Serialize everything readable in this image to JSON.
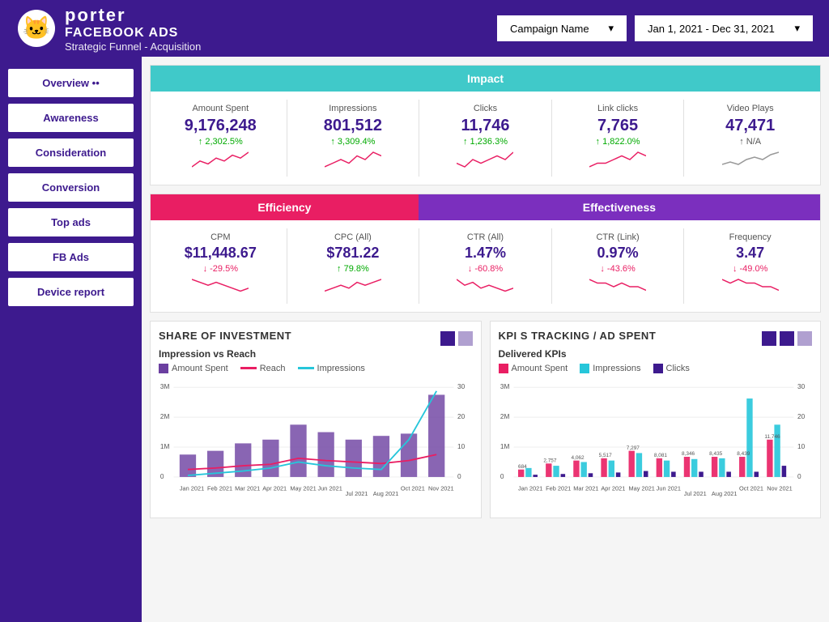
{
  "header": {
    "brand": "porter",
    "ad_platform": "FACEBOOK ADS",
    "subtitle": "Strategic Funnel - Acquisition",
    "campaign_dropdown": {
      "label": "Campaign Name",
      "arrow": "▾"
    },
    "date_dropdown": {
      "label": "Jan 1, 2021 - Dec 31, 2021",
      "arrow": "▾"
    }
  },
  "sidebar": {
    "items": [
      {
        "id": "overview",
        "label": "Overview ••"
      },
      {
        "id": "awareness",
        "label": "Awareness"
      },
      {
        "id": "consideration",
        "label": "Consideration"
      },
      {
        "id": "conversion",
        "label": "Conversion"
      },
      {
        "id": "top-ads",
        "label": "Top ads"
      },
      {
        "id": "fb-ads",
        "label": "FB Ads"
      },
      {
        "id": "device-report",
        "label": "Device report"
      }
    ]
  },
  "impact": {
    "section_title": "Impact",
    "metrics": [
      {
        "label": "Amount Spent",
        "value": "9,176,248",
        "change": "↑ 2,302.5%",
        "direction": "up"
      },
      {
        "label": "Impressions",
        "value": "801,512",
        "change": "↑ 3,309.4%",
        "direction": "up"
      },
      {
        "label": "Clicks",
        "value": "11,746",
        "change": "↑ 1,236.3%",
        "direction": "up"
      },
      {
        "label": "Link clicks",
        "value": "7,765",
        "change": "↑ 1,822.0%",
        "direction": "up"
      },
      {
        "label": "Video Plays",
        "value": "47,471",
        "change": "↑ N/A",
        "direction": "neutral"
      }
    ]
  },
  "efficiency": {
    "header": "Efficiency",
    "metrics": [
      {
        "label": "CPM",
        "value": "$11,448.67",
        "change": "↓ -29.5%",
        "direction": "down"
      },
      {
        "label": "CPC (All)",
        "value": "$781.22",
        "change": "↑ 79.8%",
        "direction": "up"
      }
    ]
  },
  "effectiveness": {
    "header": "Effectiveness",
    "metrics": [
      {
        "label": "CTR (All)",
        "value": "1.47%",
        "change": "↓ -60.8%",
        "direction": "down"
      },
      {
        "label": "CTR (Link)",
        "value": "0.97%",
        "change": "↓ -43.6%",
        "direction": "down"
      },
      {
        "label": "Frequency",
        "value": "3.47",
        "change": "↓ -49.0%",
        "direction": "down"
      }
    ]
  },
  "share_of_investment": {
    "title": "SHARE OF INVESTMENT",
    "chart_subtitle": "Impression vs Reach",
    "legend": [
      {
        "label": "Amount Spent",
        "color": "#6b3fa0",
        "type": "bar"
      },
      {
        "label": "Reach",
        "color": "#e91e63",
        "type": "line"
      },
      {
        "label": "Impressions",
        "color": "#26c6da",
        "type": "line"
      }
    ],
    "months": [
      "Jan 2021",
      "Feb 2021",
      "Mar 2021",
      "Apr 2021",
      "May 2021",
      "Jun 2021",
      "Jul 2021",
      "Aug 2021",
      "Oct 2021",
      "Nov 2021"
    ],
    "y_axis": [
      "3M",
      "2M",
      "1M",
      "0"
    ],
    "y_axis_right": [
      "30",
      "20",
      "10",
      "0"
    ]
  },
  "kpi_tracking": {
    "title": "KPI s TRACKING / AD SPENT",
    "chart_subtitle": "Delivered KPIs",
    "legend": [
      {
        "label": "Amount Spent",
        "color": "#e91e63",
        "type": "bar"
      },
      {
        "label": "Impressions",
        "color": "#26c6da",
        "type": "bar"
      },
      {
        "label": "Clicks",
        "color": "#3d1a8e",
        "type": "bar"
      }
    ],
    "values": [
      "684",
      "2,757",
      "4,062",
      "5,517",
      "7,297",
      "8,081",
      "8,346",
      "8,435",
      "8,439",
      "11,746"
    ],
    "months": [
      "Jan 2021",
      "Feb 2021",
      "Mar 2021",
      "Apr 2021",
      "May 2021",
      "Jun 2021",
      "Jul 2021",
      "Aug 2021",
      "Oct 2021",
      "Nov 2021"
    ],
    "y_axis": [
      "3M",
      "2M",
      "1M",
      "0"
    ],
    "y_axis_right": [
      "30",
      "20",
      "10",
      "0"
    ]
  }
}
